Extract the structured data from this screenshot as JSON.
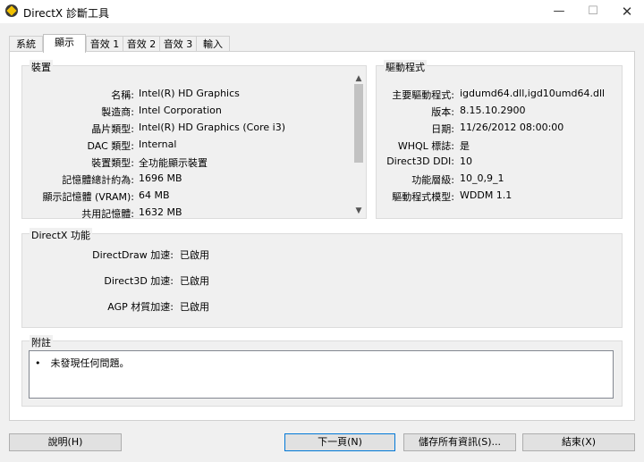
{
  "window": {
    "title": "DirectX 診斷工具",
    "minimize": "—",
    "maximize": "☐",
    "close": "✕"
  },
  "tabs": [
    {
      "label": "系統"
    },
    {
      "label": "顯示"
    },
    {
      "label": "音效 1"
    },
    {
      "label": "音效 2"
    },
    {
      "label": "音效 3"
    },
    {
      "label": "輸入"
    }
  ],
  "device": {
    "title": "裝置",
    "rows": [
      {
        "label": "名稱:",
        "value": "Intel(R) HD Graphics"
      },
      {
        "label": "製造商:",
        "value": "Intel Corporation"
      },
      {
        "label": "晶片類型:",
        "value": "Intel(R) HD Graphics (Core i3)"
      },
      {
        "label": "DAC 類型:",
        "value": "Internal"
      },
      {
        "label": "裝置類型:",
        "value": "全功能顯示裝置"
      },
      {
        "label": "記憶體總計約為:",
        "value": "1696 MB"
      },
      {
        "label": "顯示記憶體 (VRAM):",
        "value": "64 MB"
      },
      {
        "label": "共用記憶體:",
        "value": "1632 MB"
      }
    ]
  },
  "drivers": {
    "title": "驅動程式",
    "rows": [
      {
        "label": "主要驅動程式:",
        "value": "igdumd64.dll,igd10umd64.dll"
      },
      {
        "label": "版本:",
        "value": "8.15.10.2900"
      },
      {
        "label": "日期:",
        "value": "11/26/2012 08:00:00"
      },
      {
        "label": "WHQL 標誌:",
        "value": "是"
      },
      {
        "label": "Direct3D DDI:",
        "value": "10"
      },
      {
        "label": "功能層級:",
        "value": "10_0,9_1"
      },
      {
        "label": "驅動程式模型:",
        "value": "WDDM 1.1"
      }
    ]
  },
  "directx": {
    "title": "DirectX 功能",
    "rows": [
      {
        "label": "DirectDraw 加速:",
        "value": "已啟用"
      },
      {
        "label": "Direct3D 加速:",
        "value": "已啟用"
      },
      {
        "label": "AGP 材質加速:",
        "value": "已啟用"
      }
    ]
  },
  "notes": {
    "title": "附註",
    "items": [
      {
        "bullet": "•",
        "text": "未發現任何問題。"
      }
    ]
  },
  "scroll": {
    "up": "▲",
    "down": "▼"
  },
  "buttons": {
    "help": "說明(H)",
    "next": "下一頁(N)",
    "save": "儲存所有資訊(S)...",
    "exit": "結束(X)"
  }
}
